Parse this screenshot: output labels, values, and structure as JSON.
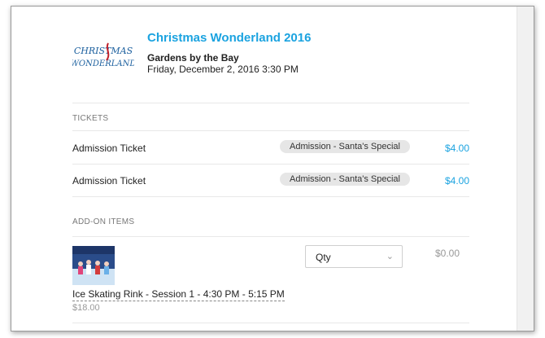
{
  "event": {
    "logo_text_line1": "CHRISTMAS",
    "logo_text_line2": "WONDERLAND",
    "title": "Christmas Wonderland 2016",
    "venue": "Gardens by the Bay",
    "datetime": "Friday, December 2, 2016 3:30 PM"
  },
  "tickets": {
    "section_label": "TICKETS",
    "items": [
      {
        "name": "Admission Ticket",
        "type": "Admission - Santa's Special",
        "price": "$4.00"
      },
      {
        "name": "Admission Ticket",
        "type": "Admission - Santa's Special",
        "price": "$4.00"
      }
    ]
  },
  "addons": {
    "section_label": "ADD-ON ITEMS",
    "items": [
      {
        "name": "Ice Skating Rink - Session 1 - 4:30 PM - 5:15 PM",
        "base_price": "$18.00",
        "qty_label": "Qty",
        "line_price": "$0.00"
      }
    ]
  },
  "colors": {
    "accent": "#1ba3e0",
    "divider": "#e8e8e8",
    "badge_bg": "#e6e6e6"
  },
  "icons": {
    "qty_chevron": "chevron-down-icon"
  }
}
